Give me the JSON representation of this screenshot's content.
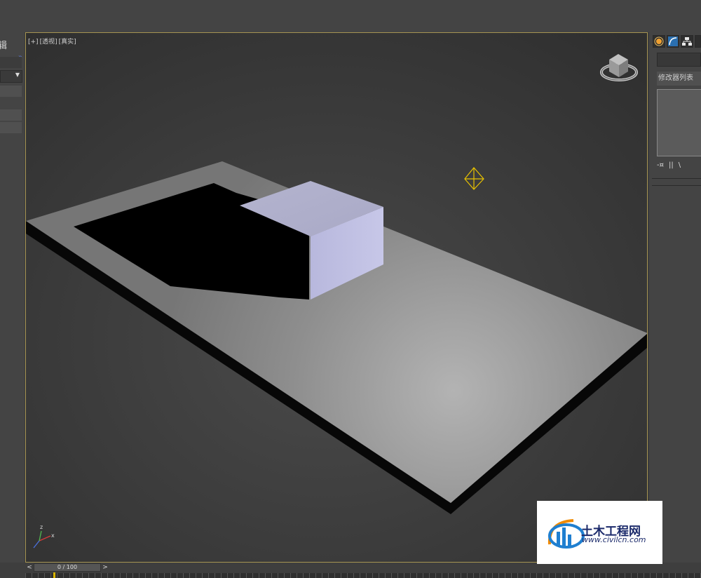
{
  "left_panel": {
    "title": "辑",
    "expand_icon": "chevron-double-right"
  },
  "viewport": {
    "label_plus": "[+]",
    "label_view": "[透视]",
    "label_shading": "[真实]",
    "border_color": "#a69452",
    "axis_labels": {
      "x": "x",
      "y": "y",
      "z": "z"
    }
  },
  "right_panel": {
    "tabs": [
      "create-icon",
      "modify-icon",
      "hierarchy-icon"
    ],
    "modifier_list_label": "修改器列表",
    "stack_tools": [
      "-¤",
      "||",
      "\\"
    ]
  },
  "timeline": {
    "frame_readout": "0 / 100",
    "prev_label": "<",
    "next_label": ">"
  },
  "watermark": {
    "brand_text": "土木工程网",
    "url_text": "www.civilcn.com"
  }
}
